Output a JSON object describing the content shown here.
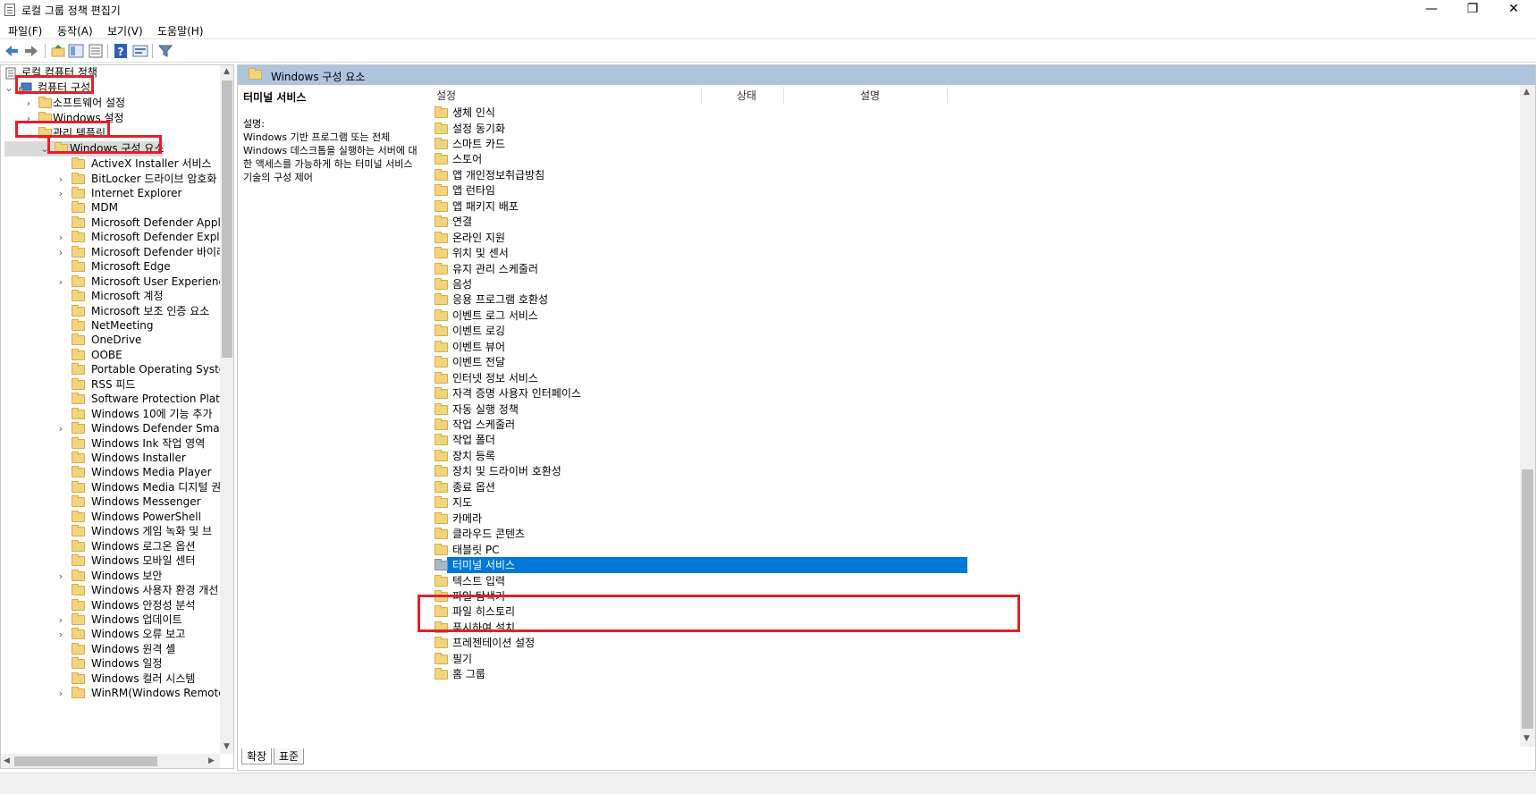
{
  "window": {
    "title": "로컬 그룹 정책 편집기",
    "minimize": "—",
    "maximize": "❐",
    "close": "✕"
  },
  "menu": [
    "파일(F)",
    "동작(A)",
    "보기(V)",
    "도움말(H)"
  ],
  "toolbar": [
    "back-icon",
    "forward-icon",
    "up-folder-icon",
    "show-hide-tree-icon",
    "export-list-icon",
    "help-icon",
    "properties-icon",
    "filter-icon"
  ],
  "tree": {
    "root": "로컬 컴퓨터 정책",
    "computer_config": "컴퓨터 구성",
    "software_settings": "소프트웨어 설정",
    "windows_settings": "Windows 설정",
    "admin_templates": "관리 템플릿",
    "windows_components": "Windows 구성 요소",
    "items": [
      {
        "label": "ActiveX Installer 서비스",
        "expandable": false
      },
      {
        "label": "BitLocker 드라이브 암호화",
        "expandable": true
      },
      {
        "label": "Internet Explorer",
        "expandable": true
      },
      {
        "label": "MDM",
        "expandable": false
      },
      {
        "label": "Microsoft Defender Applic",
        "expandable": false
      },
      {
        "label": "Microsoft Defender Exploi",
        "expandable": true
      },
      {
        "label": "Microsoft Defender 바이러",
        "expandable": true
      },
      {
        "label": "Microsoft Edge",
        "expandable": false
      },
      {
        "label": "Microsoft User Experience",
        "expandable": true
      },
      {
        "label": "Microsoft 계정",
        "expandable": false
      },
      {
        "label": "Microsoft 보조 인증 요소",
        "expandable": false
      },
      {
        "label": "NetMeeting",
        "expandable": false
      },
      {
        "label": "OneDrive",
        "expandable": false
      },
      {
        "label": "OOBE",
        "expandable": false
      },
      {
        "label": "Portable Operating System",
        "expandable": false
      },
      {
        "label": "RSS 피드",
        "expandable": false
      },
      {
        "label": "Software Protection Platfo",
        "expandable": false
      },
      {
        "label": "Windows 10에 기능 추가",
        "expandable": false
      },
      {
        "label": "Windows Defender Smarts",
        "expandable": true
      },
      {
        "label": "Windows Ink 작업 영역",
        "expandable": false
      },
      {
        "label": "Windows Installer",
        "expandable": false
      },
      {
        "label": "Windows Media Player",
        "expandable": false
      },
      {
        "label": "Windows Media 디지털 권",
        "expandable": false
      },
      {
        "label": "Windows Messenger",
        "expandable": false
      },
      {
        "label": "Windows PowerShell",
        "expandable": false
      },
      {
        "label": "Windows 게임 녹화 및 브",
        "expandable": false
      },
      {
        "label": "Windows 로그온 옵션",
        "expandable": false
      },
      {
        "label": "Windows 모바일 센터",
        "expandable": false
      },
      {
        "label": "Windows 보안",
        "expandable": true
      },
      {
        "label": "Windows 사용자 환경 개선",
        "expandable": false
      },
      {
        "label": "Windows 안정성 분석",
        "expandable": false
      },
      {
        "label": "Windows 업데이트",
        "expandable": true
      },
      {
        "label": "Windows 오류 보고",
        "expandable": true
      },
      {
        "label": "Windows 원격 셸",
        "expandable": false
      },
      {
        "label": "Windows 일정",
        "expandable": false
      },
      {
        "label": "Windows 컬러 시스템",
        "expandable": false
      },
      {
        "label": "WinRM(Windows Remote",
        "expandable": true
      }
    ]
  },
  "pane": {
    "header": "Windows 구성 요소",
    "ext_title": "터미널 서비스",
    "ext_desc_label": "설명:",
    "ext_desc": "Windows 기반 프로그램 또는 전체 Windows 데스크톱을 실행하는 서버에 대한 액세스를 가능하게 하는 터미널 서비스 기술의 구성 제어",
    "columns": [
      "설정",
      "상태",
      "설명"
    ],
    "selected": "터미널 서비스",
    "items": [
      "생체 인식",
      "설정 동기화",
      "스마트 카드",
      "스토어",
      "앱 개인정보취급방침",
      "앱 런타임",
      "앱 패키지 배포",
      "연결",
      "온라인 지원",
      "위치 및 센서",
      "유지 관리 스케줄러",
      "음성",
      "응용 프로그램 호환성",
      "이벤트 로그 서비스",
      "이벤트 로깅",
      "이벤트 뷰어",
      "이벤트 전달",
      "인터넷 정보 서비스",
      "자격 증명 사용자 인터페이스",
      "자동 실행 정책",
      "작업 스케줄러",
      "작업 폴더",
      "장치 등록",
      "장치 및 드라이버 호환성",
      "종료 옵션",
      "지도",
      "카메라",
      "클라우드 콘텐츠",
      "태블릿 PC",
      "터미널 서비스",
      "텍스트 입력",
      "파일 탐색기",
      "파일 히스토리",
      "푸시하여 설치",
      "프레젠테이션 설정",
      "필기",
      "홈 그룹"
    ]
  },
  "tabs": [
    "확장",
    "표준"
  ],
  "colors": {
    "selection": "#0078d7",
    "header": "#aec5dd",
    "highlight": "#e2202a"
  }
}
